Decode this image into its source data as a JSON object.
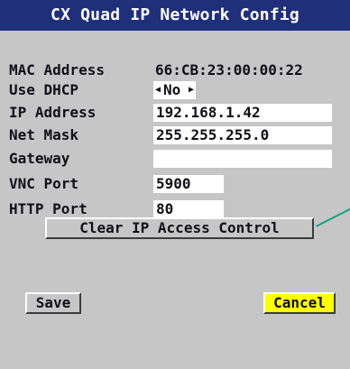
{
  "window": {
    "title": "CX Quad IP Network Config"
  },
  "fields": {
    "mac_label": "MAC Address",
    "mac_value": "66:CB:23:00:00:22",
    "dhcp_label": "Use DHCP",
    "dhcp_value": "No",
    "ip_label": "IP Address",
    "ip_value": "192.168.1.42",
    "mask_label": "Net Mask",
    "mask_value": "255.255.255.0",
    "gateway_label": "Gateway",
    "gateway_value": "",
    "vnc_label": "VNC Port",
    "vnc_value": "5900",
    "http_label": "HTTP Port",
    "http_value": "80"
  },
  "buttons": {
    "clear_ip_access": "Clear IP Access Control",
    "save": "Save",
    "cancel": "Cancel"
  },
  "icons": {
    "left_arrow": "◀",
    "right_arrow": "▶"
  },
  "colors": {
    "titlebar": "#1f2f7a",
    "background": "#c6c6c6",
    "cancel_highlight": "#ffff00",
    "callout_line": "#16a382"
  }
}
